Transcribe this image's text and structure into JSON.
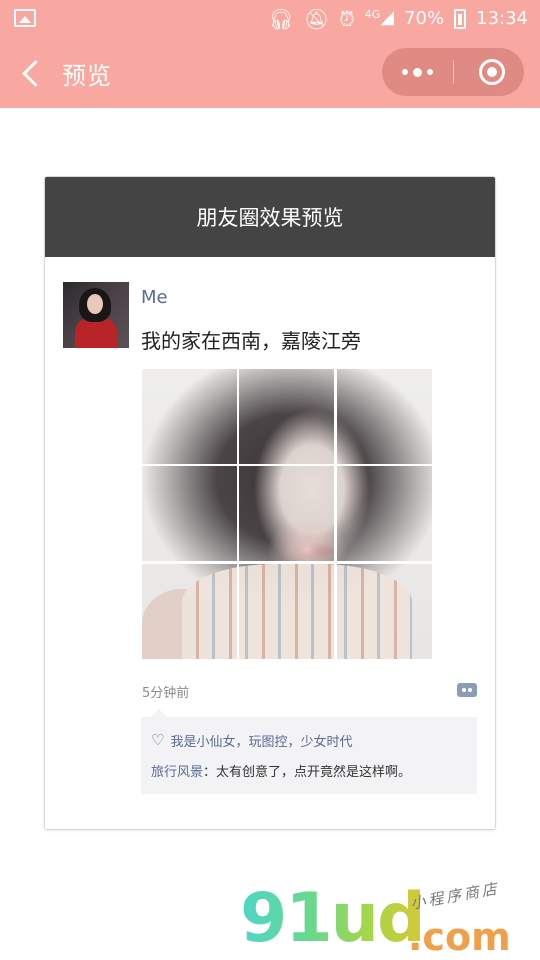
{
  "status_bar": {
    "battery": "70%",
    "network": "4G",
    "time": "13:34"
  },
  "nav": {
    "title": "预览"
  },
  "card": {
    "header_title": "朋友圈效果预览",
    "post": {
      "username": "Me",
      "text": "我的家在西南，嘉陵江旁",
      "time_ago": "5分钟前",
      "likes": "我是小仙女，玩图控，少女时代",
      "comment_author": "旅行风景",
      "comment_sep": "：",
      "comment_text": "太有创意了，点开竟然是这样啊。"
    }
  },
  "watermark": {
    "brand": "91ud",
    "domain": ".com",
    "tagline": "小程序商店"
  }
}
